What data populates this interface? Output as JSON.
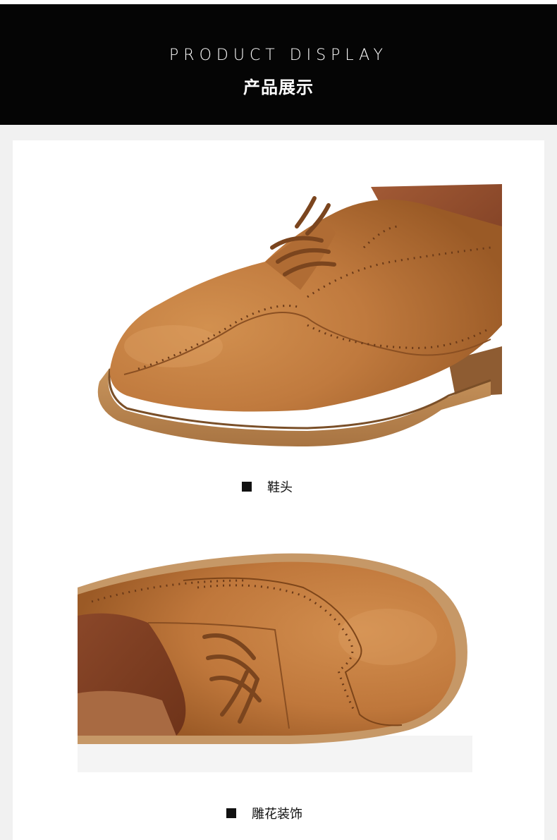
{
  "header": {
    "title_en": "PRODUCT DISPLAY",
    "title_cn": "产品展示"
  },
  "sections": [
    {
      "caption": "鞋头",
      "image_alt": "brown leather brogue shoe toe close-up"
    },
    {
      "caption": "雕花装饰",
      "image_alt": "brogue perforated wingtip decoration close-up"
    }
  ],
  "colors": {
    "header_bg": "#050505",
    "page_bg": "#f1f1f1",
    "card_bg": "#ffffff",
    "leather": "#c07a3e",
    "sole": "#b8854f"
  }
}
